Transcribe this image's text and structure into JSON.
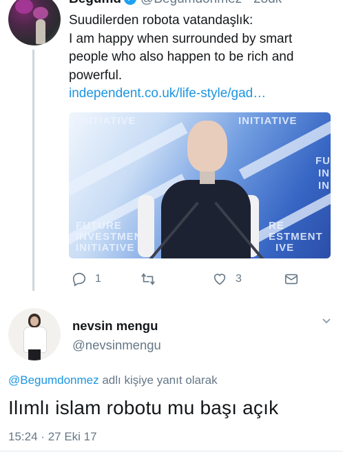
{
  "original_tweet": {
    "display_name": "Begumd",
    "handle": "@Begumdonmez",
    "time": "28dk",
    "separator": "·",
    "lines": [
      "Suudilerden robota vatandaşlık:",
      "I am happy when surrounded by smart",
      "people who also happen to be rich and",
      "powerful."
    ],
    "link": "independent.co.uk/life-style/gad…",
    "media": {
      "overlay_texts": [
        "INITIATIVE",
        "INITIATIVE",
        "FUTURE",
        "INVESTMENT",
        "INITIATIVE",
        "RE",
        "ESTMENT",
        "IVE",
        "FU",
        "IN",
        "IN"
      ]
    },
    "actions": {
      "reply_count": "1",
      "retweet_count": "",
      "like_count": "3"
    },
    "icons": [
      "reply-icon",
      "retweet-icon",
      "like-icon",
      "direct-message-icon"
    ]
  },
  "reply_tweet": {
    "display_name": "nevsin mengu",
    "handle": "@nevsinmengu",
    "replying_handle": "@Begumdonmez",
    "replying_suffix": "adlı kişiye yanıt olarak",
    "text": "Ilımlı islam robotu mu başı açık",
    "time": "15:24",
    "separator": "·",
    "date": "27 Eki 17"
  },
  "colors": {
    "link": "#1b95e0",
    "secondary_text": "#657786",
    "verified": "#1da1f2",
    "thread_line": "#ccd6dd"
  }
}
